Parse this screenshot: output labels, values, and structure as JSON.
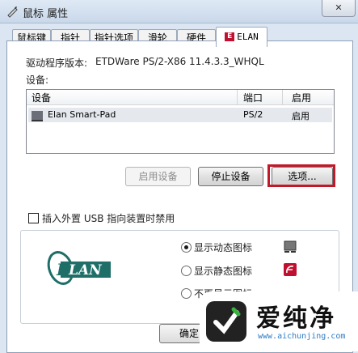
{
  "window": {
    "title": "鼠标 属性",
    "close_label": "✕"
  },
  "tabs": [
    "鼠标键",
    "指针",
    "指针选项",
    "滑轮",
    "硬件",
    "ELAN"
  ],
  "driver": {
    "label": "驱动程序版本:",
    "value": "ETDWare PS/2-X86 11.4.3.3_WHQL"
  },
  "devices": {
    "label": "设备:",
    "columns": [
      "设备",
      "端口",
      "启用"
    ],
    "rows": [
      {
        "name": "Elan Smart-Pad",
        "port": "PS/2",
        "enabled": "启用"
      }
    ]
  },
  "buttons": {
    "enable": "启用设备",
    "stop": "停止设备",
    "options": "选项..."
  },
  "checkbox": {
    "label": "插入外置 USB 指向装置时禁用",
    "checked": false
  },
  "logo": {
    "text": "LAN",
    "initial": "E"
  },
  "icon_options": {
    "selected_index": 0,
    "items": [
      "显示动态图标",
      "显示静态图标",
      "不再显示图标"
    ]
  },
  "footer": {
    "ok": "确定"
  },
  "watermark": {
    "text": "爱纯净",
    "url": "www.aichunjing.com"
  },
  "colors": {
    "highlight": "#c01a2a",
    "logo_green": "#1f6e68",
    "elan_red": "#c0102f"
  }
}
